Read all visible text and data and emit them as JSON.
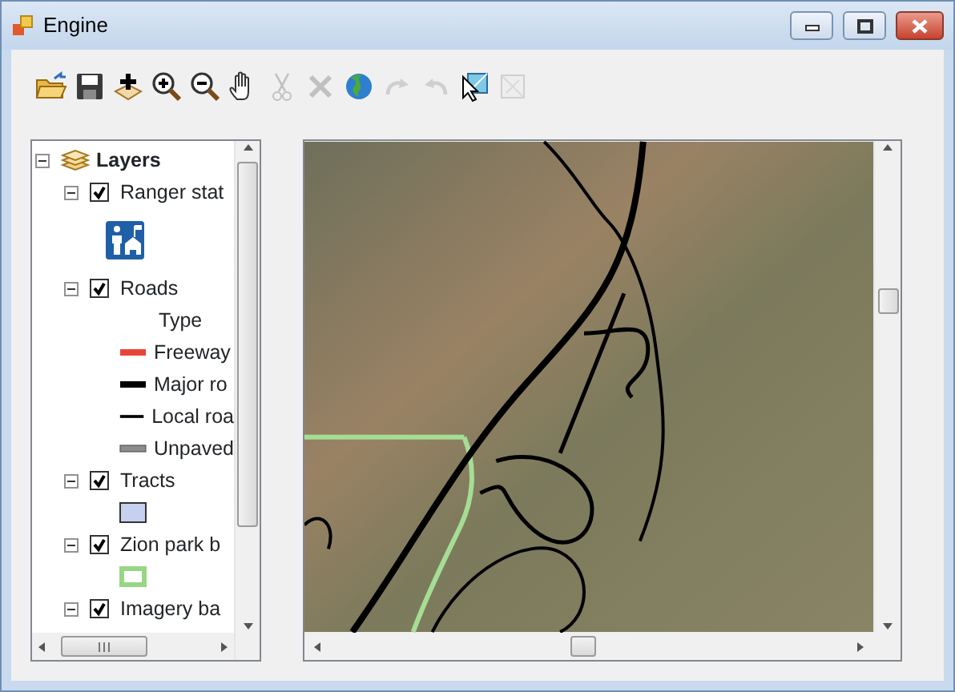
{
  "window": {
    "title": "Engine"
  },
  "toolbar": [
    {
      "kind": "open",
      "disabled": false
    },
    {
      "kind": "save",
      "disabled": false
    },
    {
      "kind": "add-data",
      "disabled": false
    },
    {
      "kind": "zoom-in",
      "disabled": false
    },
    {
      "kind": "zoom-out",
      "disabled": false
    },
    {
      "kind": "pan",
      "disabled": false
    },
    {
      "kind": "cut",
      "disabled": true
    },
    {
      "kind": "delete",
      "disabled": true
    },
    {
      "kind": "globe",
      "disabled": false
    },
    {
      "kind": "redo",
      "disabled": true
    },
    {
      "kind": "undo",
      "disabled": true
    },
    {
      "kind": "select",
      "disabled": false
    },
    {
      "kind": "frame",
      "disabled": true
    }
  ],
  "toc": {
    "label": "Layers",
    "expanded": true,
    "children": [
      {
        "label": "Ranger stat",
        "checked": true,
        "expanded": true,
        "legend": [
          {
            "kind": "symbol"
          }
        ]
      },
      {
        "label": "Roads",
        "checked": true,
        "expanded": true,
        "legend": [
          {
            "kind": "heading",
            "label": "Type"
          },
          {
            "kind": "thick-line",
            "label": "Freeway",
            "color": "#e8453a"
          },
          {
            "kind": "thick-line",
            "label": "Major ro",
            "color": "#000000"
          },
          {
            "kind": "thin-line",
            "label": "Local roa",
            "color": "#000000"
          },
          {
            "kind": "double-line",
            "label": "Unpaved",
            "color": "#8c8c8c"
          }
        ]
      },
      {
        "label": "Tracts",
        "checked": true,
        "expanded": true,
        "legend": [
          {
            "kind": "fill",
            "color": "#c6d0ef"
          }
        ]
      },
      {
        "label": "Zion park b",
        "checked": true,
        "expanded": true,
        "legend": [
          {
            "kind": "outline",
            "color": "#97d684"
          }
        ]
      },
      {
        "label": "Imagery ba",
        "checked": true,
        "expanded": true
      }
    ]
  }
}
